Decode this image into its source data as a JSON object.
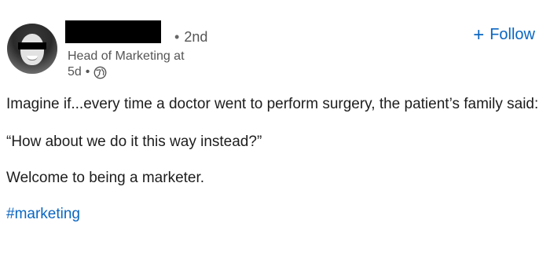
{
  "author": {
    "degree": "2nd",
    "headline": "Head of Marketing at",
    "post_age": "5d",
    "visibility_icon": "globe-icon"
  },
  "actions": {
    "follow_label": "Follow",
    "follow_icon": "plus-icon",
    "accent_color": "#0a66c2"
  },
  "post": {
    "line1": "Imagine if...every time a doctor went to perform surgery, the patient’s family said:",
    "line2": "“How about we do it this way instead?”",
    "line3": "Welcome to being a marketer.",
    "hashtag": "#marketing"
  }
}
